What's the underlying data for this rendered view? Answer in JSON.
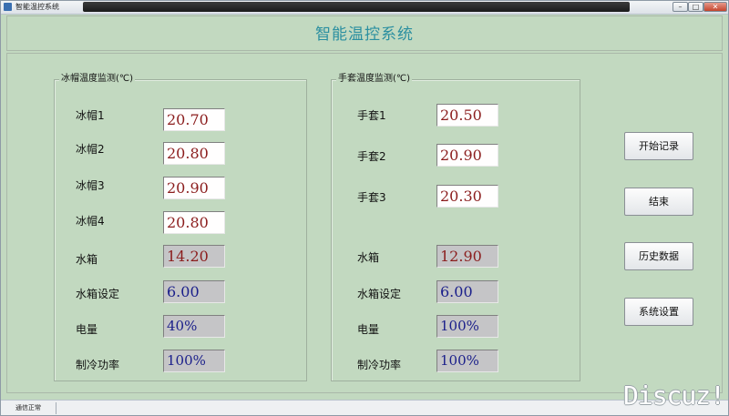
{
  "window": {
    "title": "智能温控系统"
  },
  "header": {
    "title": "智能温控系统"
  },
  "cap_group": {
    "title": "冰帽温度监测(℃)",
    "rows": [
      {
        "label": "冰帽1",
        "value": "20.70"
      },
      {
        "label": "冰帽2",
        "value": "20.80"
      },
      {
        "label": "冰帽3",
        "value": "20.90"
      },
      {
        "label": "冰帽4",
        "value": "20.80"
      },
      {
        "label": "水箱",
        "value": "14.20"
      },
      {
        "label": "水箱设定",
        "value": "6.00"
      },
      {
        "label": "电量",
        "value": "40%"
      },
      {
        "label": "制冷功率",
        "value": "100%"
      }
    ]
  },
  "glove_group": {
    "title": "手套温度监测(℃)",
    "rows": [
      {
        "label": "手套1",
        "value": "20.50"
      },
      {
        "label": "手套2",
        "value": "20.90"
      },
      {
        "label": "手套3",
        "value": "20.30"
      },
      {
        "label": "水箱",
        "value": "12.90"
      },
      {
        "label": "水箱设定",
        "value": "6.00"
      },
      {
        "label": "电量",
        "value": "100%"
      },
      {
        "label": "制冷功率",
        "value": "100%"
      }
    ]
  },
  "buttons": {
    "start_record": "开始记录",
    "end": "结束",
    "history": "历史数据",
    "settings": "系统设置"
  },
  "status": {
    "text": "通信正常"
  },
  "watermark": "Discuz!",
  "titlebar_buttons": {
    "minimize": "–",
    "maximize": "□",
    "close": "✕"
  },
  "colors": {
    "background": "#c2d9c0",
    "title": "#2b8fa0",
    "value_red": "#8b1d1d",
    "value_blue": "#1a1e8a",
    "readonly_bg": "#c5c5c7"
  }
}
